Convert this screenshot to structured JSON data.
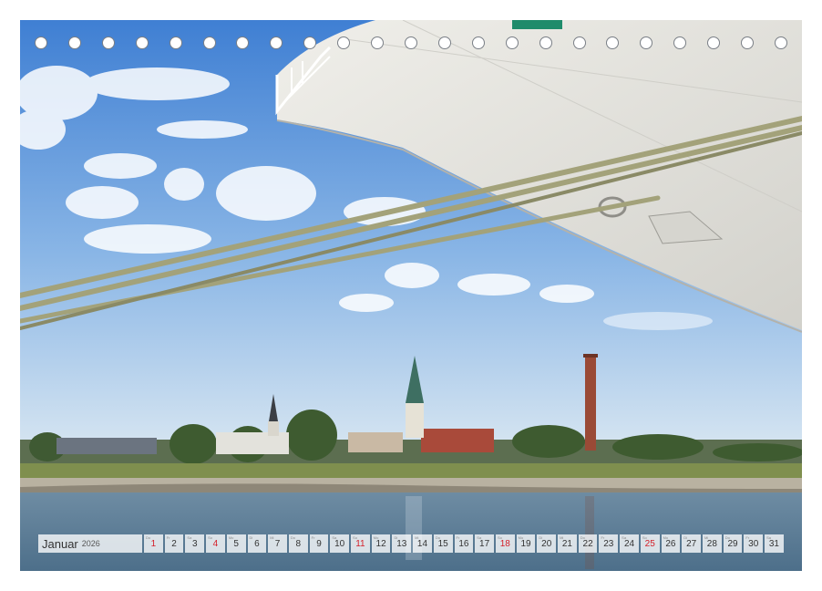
{
  "calendar": {
    "month": "Januar",
    "year": "2026",
    "days": [
      {
        "n": "1",
        "wd": "Do",
        "sun": true
      },
      {
        "n": "2",
        "wd": "Fr",
        "sun": false
      },
      {
        "n": "3",
        "wd": "Sa",
        "sun": false
      },
      {
        "n": "4",
        "wd": "So",
        "sun": true
      },
      {
        "n": "5",
        "wd": "Mo",
        "sun": false
      },
      {
        "n": "6",
        "wd": "Di",
        "sun": false
      },
      {
        "n": "7",
        "wd": "Mi",
        "sun": false
      },
      {
        "n": "8",
        "wd": "Do",
        "sun": false
      },
      {
        "n": "9",
        "wd": "Fr",
        "sun": false
      },
      {
        "n": "10",
        "wd": "Sa",
        "sun": false
      },
      {
        "n": "11",
        "wd": "So",
        "sun": true
      },
      {
        "n": "12",
        "wd": "Mo",
        "sun": false
      },
      {
        "n": "13",
        "wd": "Di",
        "sun": false
      },
      {
        "n": "14",
        "wd": "Mi",
        "sun": false
      },
      {
        "n": "15",
        "wd": "Do",
        "sun": false
      },
      {
        "n": "16",
        "wd": "Fr",
        "sun": false
      },
      {
        "n": "17",
        "wd": "Sa",
        "sun": false
      },
      {
        "n": "18",
        "wd": "So",
        "sun": true
      },
      {
        "n": "19",
        "wd": "Mo",
        "sun": false
      },
      {
        "n": "20",
        "wd": "Di",
        "sun": false
      },
      {
        "n": "21",
        "wd": "Mi",
        "sun": false
      },
      {
        "n": "22",
        "wd": "Do",
        "sun": false
      },
      {
        "n": "23",
        "wd": "Fr",
        "sun": false
      },
      {
        "n": "24",
        "wd": "Sa",
        "sun": false
      },
      {
        "n": "25",
        "wd": "So",
        "sun": true
      },
      {
        "n": "26",
        "wd": "Mo",
        "sun": false
      },
      {
        "n": "27",
        "wd": "Di",
        "sun": false
      },
      {
        "n": "28",
        "wd": "Mi",
        "sun": false
      },
      {
        "n": "29",
        "wd": "Do",
        "sun": false
      },
      {
        "n": "30",
        "wd": "Fr",
        "sun": false
      },
      {
        "n": "31",
        "wd": "Sa",
        "sun": false
      }
    ]
  },
  "binding_holes": 23,
  "colors": {
    "sky_top": "#3f7fd3",
    "sky_bottom": "#cfe0ef",
    "water": "#5a7d98",
    "hull": "#e4e3dd",
    "rope": "#a3a27a",
    "sunday": "#d4202a"
  }
}
